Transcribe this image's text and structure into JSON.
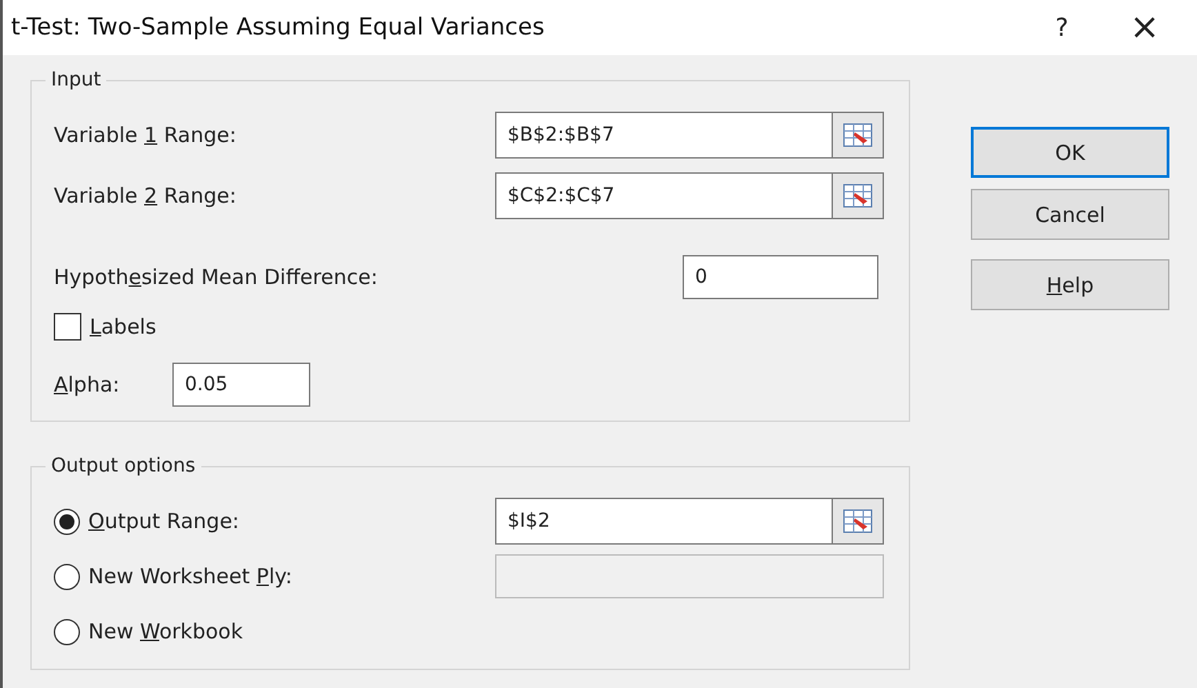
{
  "window": {
    "title": "t-Test: Two-Sample Assuming Equal Variances",
    "help_glyph": "?",
    "close_glyph": "×"
  },
  "input_group": {
    "title": "Input",
    "ranges": [
      {
        "label_before": "Variable ",
        "access_key": "1",
        "label_after": " Range:",
        "value": "$B$2:$B$7"
      },
      {
        "label_before": "Variable ",
        "access_key": "2",
        "label_after": " Range:",
        "value": "$C$2:$C$7"
      }
    ],
    "mean_difference": {
      "label_before": "Hypoth",
      "access_key": "e",
      "label_after": "sized Mean Difference:",
      "value": "0"
    },
    "labels_checkbox": {
      "access_key": "L",
      "label_after": "abels",
      "checked": false
    },
    "alpha": {
      "access_key": "A",
      "label_after": "lpha:",
      "value": "0.05"
    }
  },
  "output_group": {
    "title": "Output options",
    "options": [
      {
        "access_key": "O",
        "label_after": "utput Range:",
        "selected": true,
        "value": "$I$2",
        "kind": "range"
      },
      {
        "label_before": "New Worksheet ",
        "access_key": "P",
        "label_after": "ly:",
        "selected": false,
        "kind": "text"
      },
      {
        "label_before": "New ",
        "access_key": "W",
        "label_after": "orkbook",
        "selected": false,
        "kind": "plain"
      }
    ]
  },
  "buttons": [
    {
      "label_before": "OK",
      "default": true
    },
    {
      "label_before": "Cancel",
      "default": false
    },
    {
      "access_key": "H",
      "label_after": "elp",
      "default": false
    }
  ]
}
